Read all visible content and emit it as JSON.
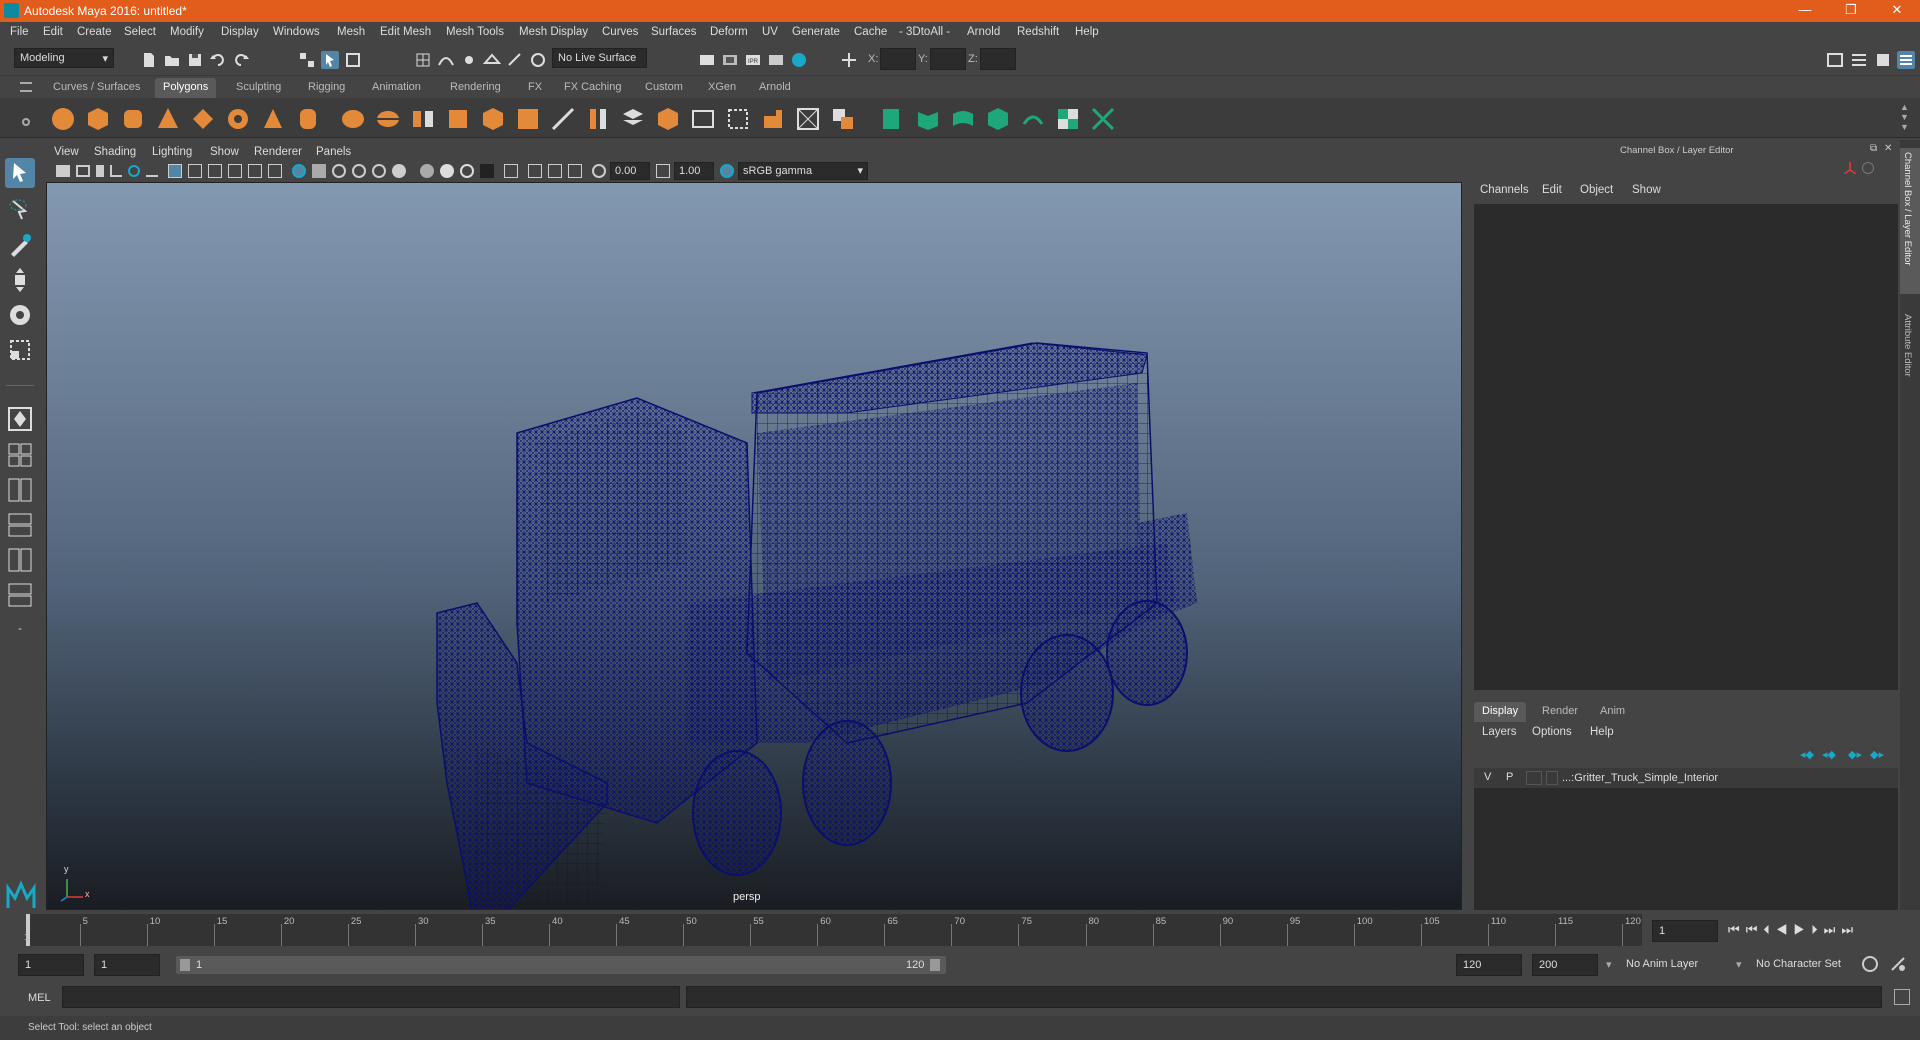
{
  "window": {
    "title": "Autodesk Maya 2016: untitled*",
    "min": "—",
    "restore": "❐",
    "close": "✕"
  },
  "menubar": [
    "File",
    "Edit",
    "Create",
    "Select",
    "Modify",
    "Display",
    "Windows",
    "Mesh",
    "Edit Mesh",
    "Mesh Tools",
    "Mesh Display",
    "Curves",
    "Surfaces",
    "Deform",
    "UV",
    "Generate",
    "Cache",
    "- 3DtoAll -",
    "Arnold",
    "Redshift",
    "Help"
  ],
  "statusline": {
    "mode": "Modeling",
    "live_surface": "No Live Surface",
    "x_label": "X:",
    "y_label": "Y:",
    "z_label": "Z:"
  },
  "shelf": {
    "tabs": [
      "Curves / Surfaces",
      "Polygons",
      "Sculpting",
      "Rigging",
      "Animation",
      "Rendering",
      "FX",
      "FX Caching",
      "Custom",
      "XGen",
      "Arnold"
    ],
    "active_tab": "Polygons"
  },
  "viewport": {
    "menu": [
      "View",
      "Shading",
      "Lighting",
      "Show",
      "Renderer",
      "Panels"
    ],
    "exposure": "0.00",
    "gamma": "1.00",
    "color_space": "sRGB gamma",
    "camera_label": "persp",
    "axis_y": "y",
    "axis_x": "x",
    "wire_color": "#0a0f6e"
  },
  "channelbox": {
    "title": "Channel Box / Layer Editor",
    "menu": [
      "Channels",
      "Edit",
      "Object",
      "Show"
    ],
    "tabs": [
      "Display",
      "Render",
      "Anim"
    ],
    "active_tab": "Display",
    "layer_menu": [
      "Layers",
      "Options",
      "Help"
    ],
    "layer": {
      "v": "V",
      "p": "P",
      "name": "...:Gritter_Truck_Simple_Interior"
    },
    "side_tabs": [
      "Channel Box / Layer Editor",
      "Attribute Editor"
    ]
  },
  "timeline": {
    "ticks": [
      "5",
      "10",
      "15",
      "20",
      "25",
      "30",
      "35",
      "40",
      "45",
      "50",
      "55",
      "60",
      "65",
      "70",
      "75",
      "80",
      "85",
      "90",
      "95",
      "100",
      "105",
      "110",
      "115",
      "120"
    ],
    "first_tick": "1",
    "current_frame": "1"
  },
  "range": {
    "start": "1",
    "start_inner": "1",
    "slider_start": "1",
    "slider_end": "120",
    "end_inner": "120",
    "end": "200",
    "anim_layer": "No Anim Layer",
    "character_set": "No Character Set"
  },
  "cmdline": {
    "label": "MEL"
  },
  "helpline": {
    "text": "Select Tool: select an object"
  }
}
